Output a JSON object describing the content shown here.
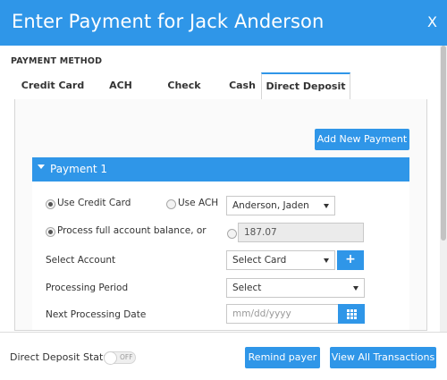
{
  "header": {
    "title": "Enter Payment for Jack Anderson",
    "close_label": "X"
  },
  "payment_method_label": "PAYMENT METHOD",
  "tabs": [
    {
      "label": "Credit Card",
      "active": false
    },
    {
      "label": "ACH",
      "active": false
    },
    {
      "label": "Check",
      "active": false
    },
    {
      "label": "Cash",
      "active": false
    },
    {
      "label": "Direct Deposit",
      "active": true
    }
  ],
  "add_new_payment_label": "Add New Payment",
  "section": {
    "title": "Payment 1"
  },
  "form": {
    "use_credit_card_label": "Use Credit Card",
    "use_credit_card_selected": true,
    "use_ach_label": "Use ACH",
    "use_ach_selected": false,
    "payer_select_value": "Anderson, Jaden",
    "process_full_label": "Process full account balance, or",
    "process_full_selected": true,
    "amount_selected": false,
    "amount_value": "187.07",
    "select_account_label": "Select Account",
    "select_account_value": "Select Card",
    "add_account_label": "+",
    "processing_period_label": "Processing Period",
    "processing_period_value": "Select",
    "next_processing_date_label": "Next Processing Date",
    "next_processing_date_placeholder": "mm/dd/yyyy"
  },
  "footer": {
    "direct_deposit_status_label": "Direct Deposit Status",
    "toggle_text": "OFF",
    "remind_payer_label": "Remind payer",
    "view_all_label": "View All Transactions"
  },
  "colors": {
    "accent": "#2f96e8"
  }
}
